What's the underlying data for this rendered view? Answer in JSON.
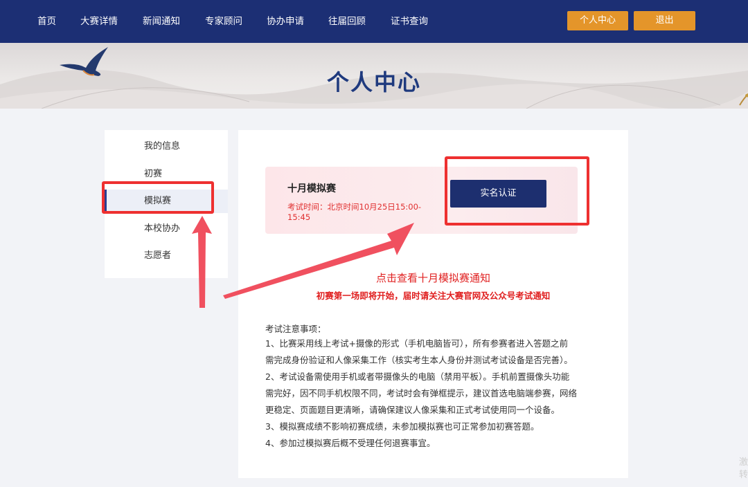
{
  "nav": {
    "items": [
      "首页",
      "大赛详情",
      "新闻通知",
      "专家顾问",
      "协办申请",
      "往届回顾",
      "证书查询"
    ],
    "personal_center": "个人中心",
    "logout": "退出"
  },
  "banner": {
    "title": "个人中心"
  },
  "sidebar": {
    "items": [
      "我的信息",
      "初赛",
      "模拟赛",
      "本校协办",
      "志愿者"
    ],
    "active": "模拟赛"
  },
  "exam_card": {
    "title": "十月模拟赛",
    "time_label": "考试时间：北京时间10月25日15:00-15:45",
    "verify_button": "实名认证"
  },
  "notice": {
    "link": "点击查看十月模拟赛通知",
    "subtitle": "初赛第一场即将开始，届时请关注大赛官网及公众号考试通知"
  },
  "notes": {
    "title": "考试注意事项：",
    "lines": [
      "1、比赛采用线上考试+摄像的形式（手机电脑皆可），所有参赛者进入答题之前",
      "需完成身份验证和人像采集工作（核实考生本人身份并测试考试设备是否完善）。",
      "2、考试设备需使用手机或者带摄像头的电脑（禁用平板）。手机前置摄像头功能",
      "需完好，因不同手机权限不同，考试时会有弹框提示，建议首选电脑端参赛，网络",
      "更稳定、页面题目更清晰，请确保建议人像采集和正式考试使用同一个设备。",
      "3、模拟赛成绩不影响初赛成绩，未参加模拟赛也可正常参加初赛答题。",
      "4、参加过模拟赛后概不受理任何退赛事宜。"
    ]
  },
  "watermark": "激转",
  "colors": {
    "nav_bg": "#1c2f74",
    "accent_orange": "#e4952a",
    "primary_button": "#1d2f6f",
    "alert_red": "#e02020",
    "annotation_red": "#ee3030"
  }
}
